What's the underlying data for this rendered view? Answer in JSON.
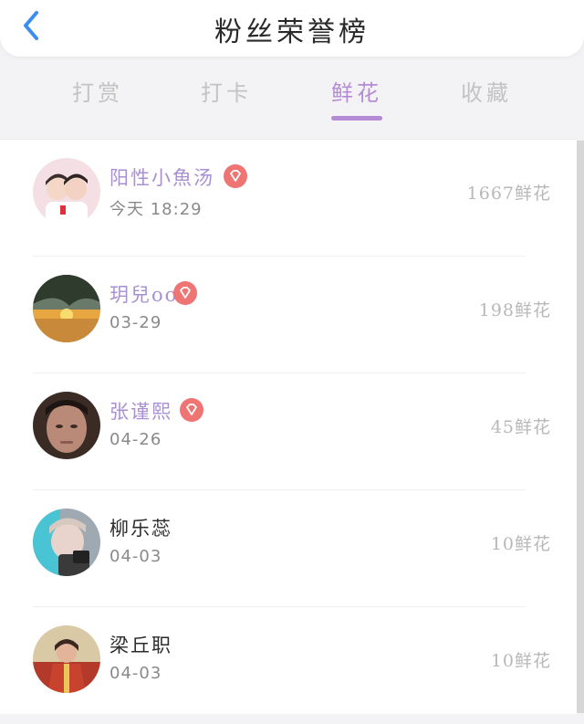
{
  "header": {
    "title": "粉丝荣誉榜",
    "back_icon": "chevron-left-icon",
    "back_color": "#3a8df5"
  },
  "tabs": [
    {
      "label": "打赏",
      "active": false
    },
    {
      "label": "打卡",
      "active": false
    },
    {
      "label": "鲜花",
      "active": true
    },
    {
      "label": "收藏",
      "active": false
    }
  ],
  "colors": {
    "accent": "#b58bd6",
    "name_highlight": "#a990d3",
    "badge": "#ef7474"
  },
  "list": {
    "rows": [
      {
        "name": "阳性小魚汤",
        "date": "今天 18:29",
        "count": "1667鲜花",
        "highlight": true,
        "badge": "gem-icon",
        "avatar": "couple-photo"
      },
      {
        "name": "玥兒oo",
        "date": "03-29",
        "count": "198鲜花",
        "highlight": true,
        "badge": "gem-icon",
        "avatar": "sunset-photo"
      },
      {
        "name": "张谨熙",
        "date": "04-26",
        "count": "45鲜花",
        "highlight": true,
        "badge": "gem-icon",
        "avatar": "face-photo"
      },
      {
        "name": "柳乐蕊",
        "date": "04-03",
        "count": "10鲜花",
        "highlight": false,
        "badge": null,
        "avatar": "selfie-photo"
      },
      {
        "name": "梁丘职",
        "date": "04-03",
        "count": "10鲜花",
        "highlight": false,
        "badge": null,
        "avatar": "warrior-photo"
      }
    ]
  }
}
